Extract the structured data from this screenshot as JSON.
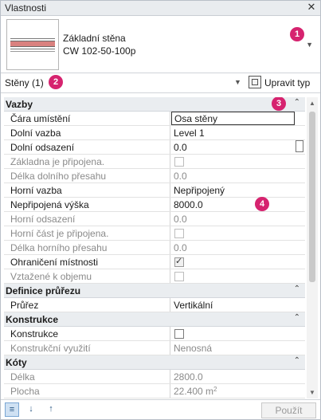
{
  "window": {
    "title": "Vlastnosti"
  },
  "type_selector": {
    "line1": "Základní stěna",
    "line2": "CW 102-50-100p"
  },
  "filter": {
    "label": "Stěny (1)",
    "edit_type": "Upravit typ"
  },
  "badges": [
    "1",
    "2",
    "3",
    "4"
  ],
  "groups": {
    "constraints": "Vazby",
    "section": "Definice průřezu",
    "construction": "Konstrukce",
    "dimensions": "Kóty"
  },
  "constraints": {
    "location_line": {
      "label": "Čára umístění",
      "value": "Osa stěny"
    },
    "base_constraint": {
      "label": "Dolní vazba",
      "value": "Level 1"
    },
    "base_offset": {
      "label": "Dolní odsazení",
      "value": "0.0"
    },
    "base_attached": {
      "label": "Základna je připojena."
    },
    "base_extension": {
      "label": "Délka dolního přesahu",
      "value": "0.0"
    },
    "top_constraint": {
      "label": "Horní vazba",
      "value": "Nepřipojený"
    },
    "unconnected_height": {
      "label": "Nepřipojená výška",
      "value": "8000.0"
    },
    "top_offset": {
      "label": "Horní odsazení",
      "value": "0.0"
    },
    "top_attached": {
      "label": "Horní část je připojena."
    },
    "top_extension": {
      "label": "Délka horního přesahu",
      "value": "0.0"
    },
    "room_bounding": {
      "label": "Ohraničení místnosti"
    },
    "related_mass": {
      "label": "Vztažené k objemu"
    }
  },
  "section": {
    "cross_section": {
      "label": "Průřez",
      "value": "Vertikální"
    }
  },
  "construction": {
    "structural": {
      "label": "Konstrukce"
    },
    "structural_usage": {
      "label": "Konstrukční využití",
      "value": "Nenosná"
    }
  },
  "dimensions": {
    "length": {
      "label": "Délka",
      "value": "2800.0"
    },
    "area": {
      "label": "Plocha",
      "value": "22.400 m",
      "unit_sup": "2"
    }
  },
  "footer": {
    "apply": "Použít"
  },
  "colors": {
    "badge": "#d6236f",
    "group_bg": "#eaedf0"
  },
  "icons": [
    "close-icon",
    "dropdown-chevron-icon",
    "edit-type-icon",
    "collapse-icon",
    "sort-category-icon",
    "sort-az-icon",
    "sort-za-icon"
  ]
}
